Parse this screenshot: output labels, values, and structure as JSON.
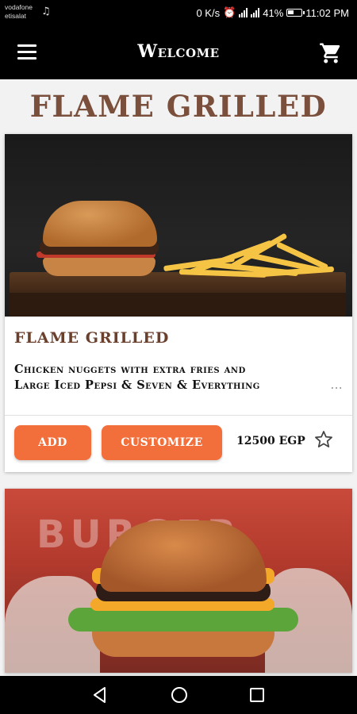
{
  "status_bar": {
    "carrier_1": "vodafone",
    "carrier_2": "etisalat",
    "speed": "0 K/s",
    "signal_1": "4G",
    "signal_2": "3G",
    "battery": "41%",
    "time": "11:02 PM"
  },
  "app_bar": {
    "title": "Welcome",
    "menu_icon": "hamburger-menu-icon",
    "cart_icon": "shopping-cart-icon"
  },
  "page": {
    "heading": "FLAME GRILLED"
  },
  "products": [
    {
      "title": "FLAME GRILLED",
      "description_line_1": "Chicken nuggets with extra fries and",
      "description_line_2": "Large Iced Pepsi & Seven & Everything",
      "ellipsis": "...",
      "add_label": "ADD",
      "customize_label": "CUSTOMIZE",
      "price": "12500 EGP",
      "favorite_icon": "star-outline-icon"
    }
  ],
  "second_card": {
    "sign_text": "BURGER"
  },
  "colors": {
    "accent": "#f26f3b",
    "heading": "#7a4f3c",
    "bar": "#000000"
  }
}
